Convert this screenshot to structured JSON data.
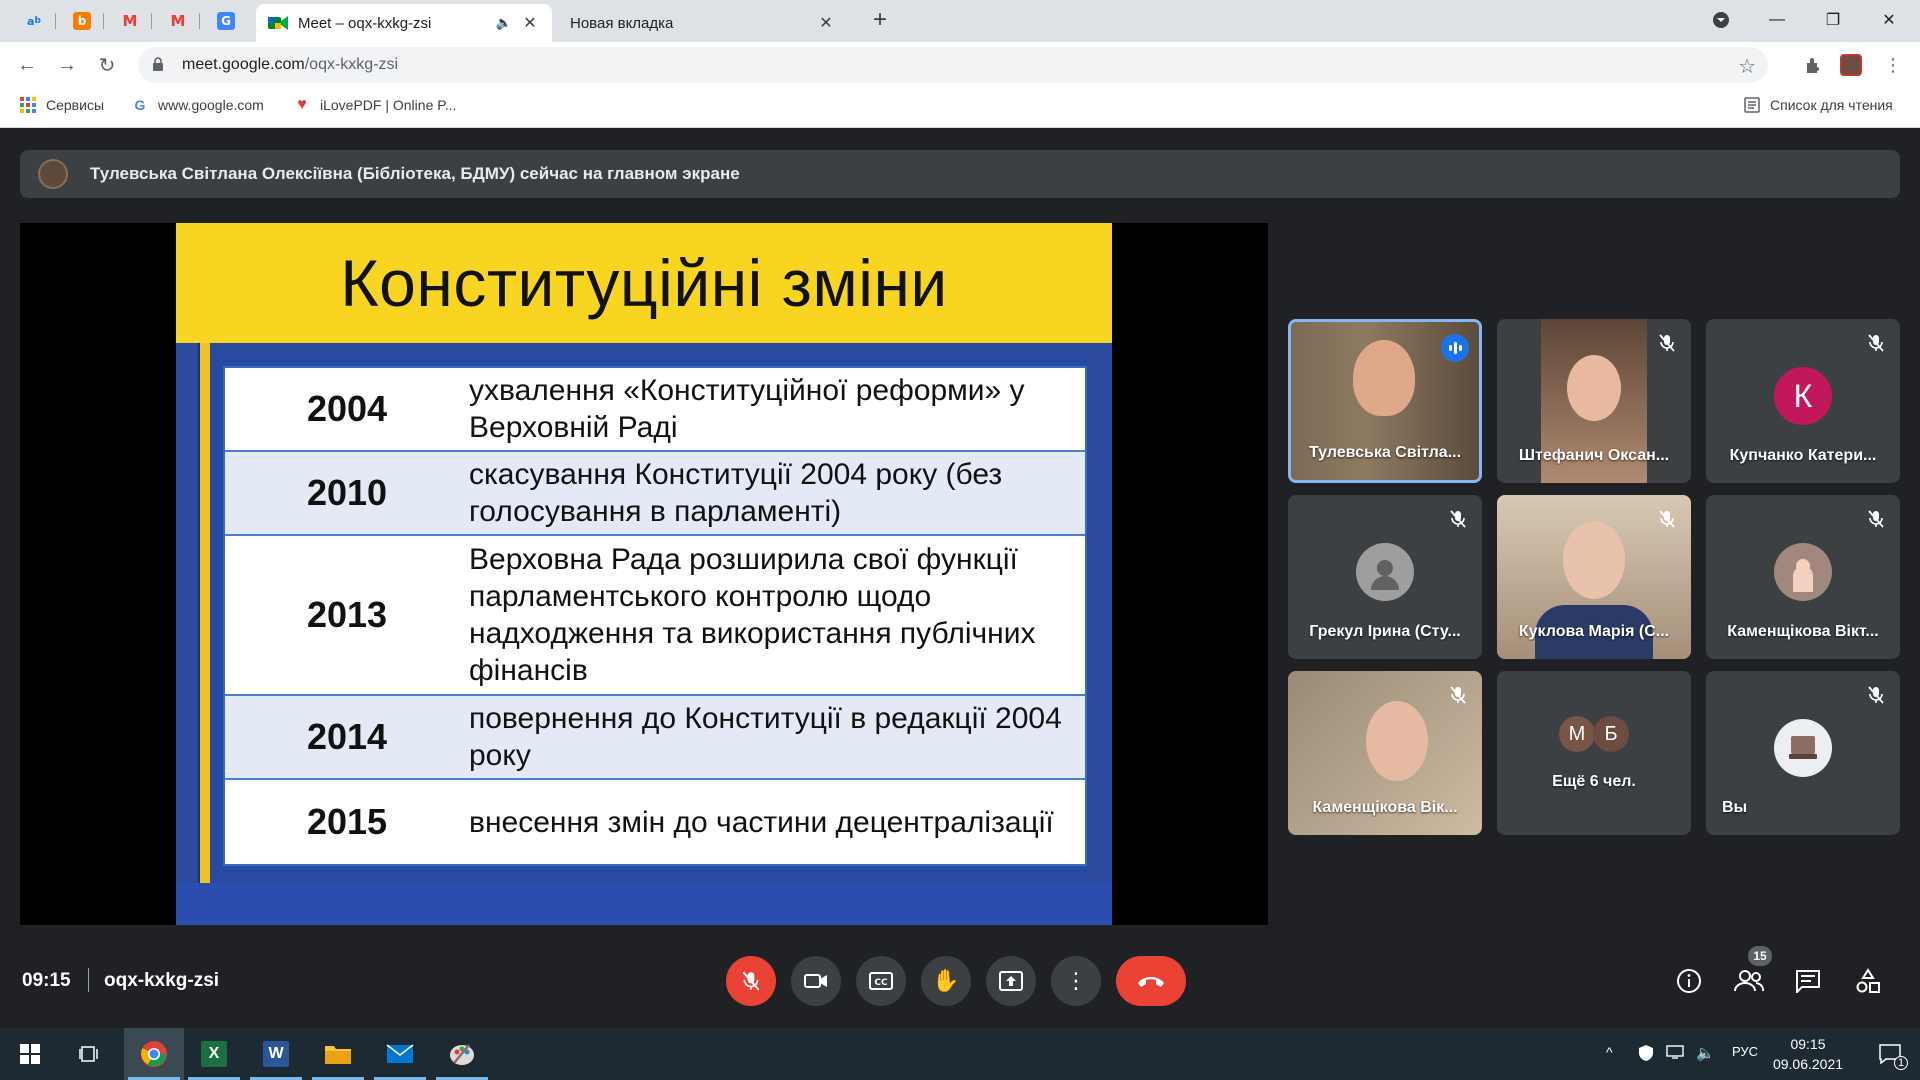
{
  "browser": {
    "pinned_tabs": [
      {
        "icon": "translate-icon"
      },
      {
        "icon": "blogger-icon"
      },
      {
        "icon": "gmail-icon"
      },
      {
        "icon": "gmail-icon"
      },
      {
        "icon": "google-translate-icon"
      }
    ],
    "tabs": [
      {
        "title": "Meet – oqx-kxkg-zsi",
        "active": true
      },
      {
        "title": "Новая вкладка",
        "active": false
      }
    ],
    "url_host": "meet.google.com",
    "url_path": "/oqx-kxkg-zsi",
    "bookmarks": [
      {
        "label": "Сервисы"
      },
      {
        "label": "www.google.com"
      },
      {
        "label": "iLovePDF | Online P..."
      }
    ],
    "reading_list": "Список для чтения"
  },
  "meet": {
    "banner_text": "Тулевська Світлана Олексіївна (Бібліотека, БДМУ) сейчас на главном экране",
    "slide": {
      "title": "Конституційні зміни",
      "rows": [
        {
          "year": "2004",
          "text": "ухвалення «Конституційної реформи» у Верховній Раді"
        },
        {
          "year": "2010",
          "text": "скасування Конституції 2004 року (без голосування в парламенті)"
        },
        {
          "year": "2013",
          "text": "Верховна Рада розширила свої функції парламентського контролю щодо надходження та використання публічних фінансів"
        },
        {
          "year": "2014",
          "text": "повернення до Конституції в редакції 2004 року"
        },
        {
          "year": "2015",
          "text": "внесення змін до частини децентралізації"
        }
      ]
    },
    "participants": [
      {
        "name": "Тулевська Світла...",
        "speaking": true
      },
      {
        "name": "Штефанич Оксан..."
      },
      {
        "name": "Купчанко Катери...",
        "initial": "К",
        "color": "#c2185b"
      },
      {
        "name": "Грекул Ірина (Сту..."
      },
      {
        "name": "Куклова Марія (С..."
      },
      {
        "name": "Каменщікова Вікт..."
      },
      {
        "name": "Каменщікова Вік..."
      },
      {
        "name": "Ещё 6 чел.",
        "initials": [
          "М",
          "Б"
        ]
      },
      {
        "name": "Вы"
      }
    ],
    "time": "09:15",
    "meeting_code": "oqx-kxkg-zsi",
    "people_count": "15"
  },
  "taskbar": {
    "lang": "РУС",
    "time": "09:15",
    "date": "09.06.2021",
    "notif_count": "1"
  },
  "colors": {
    "meet_bg": "#202124",
    "hangup_red": "#ea4335",
    "slide_yellow": "#f8d521",
    "slide_blue": "#2a4aa0"
  }
}
